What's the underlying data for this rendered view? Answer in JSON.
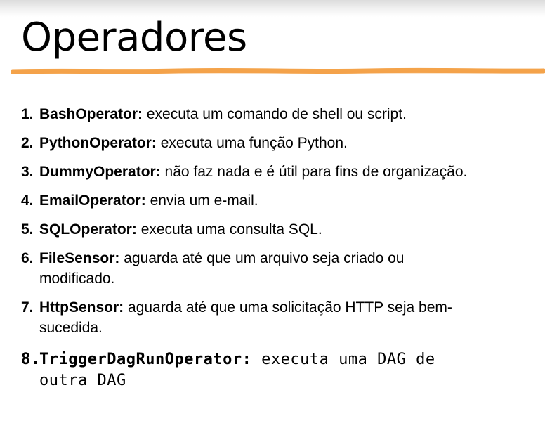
{
  "slide": {
    "title": "Operadores",
    "accent_color": "#f4a34a"
  },
  "operators": [
    {
      "number": "1.",
      "name": "BashOperator:",
      "description": [
        "executa um comando de shell ou script."
      ]
    },
    {
      "number": "2.",
      "name": "PythonOperator:",
      "description": [
        "executa uma função Python."
      ]
    },
    {
      "number": "3.",
      "name": "DummyOperator:",
      "description": [
        "não faz nada e é útil para fins de organização."
      ]
    },
    {
      "number": "4.",
      "name": "EmailOperator:",
      "description": [
        "envia um e-mail."
      ]
    },
    {
      "number": "5.",
      "name": "SQLOperator:",
      "description": [
        "executa uma consulta SQL."
      ]
    },
    {
      "number": "6.",
      "name": "FileSensor:",
      "description": [
        "aguarda até que um arquivo seja criado ou",
        "modificado."
      ]
    },
    {
      "number": "7.",
      "name": "HttpSensor:",
      "description": [
        "aguarda até que uma solicitação HTTP seja bem-",
        "sucedida."
      ]
    },
    {
      "number": "8.",
      "name": "TriggerDagRunOperator:",
      "description": [
        "executa uma DAG de",
        "outra DAG"
      ]
    }
  ]
}
